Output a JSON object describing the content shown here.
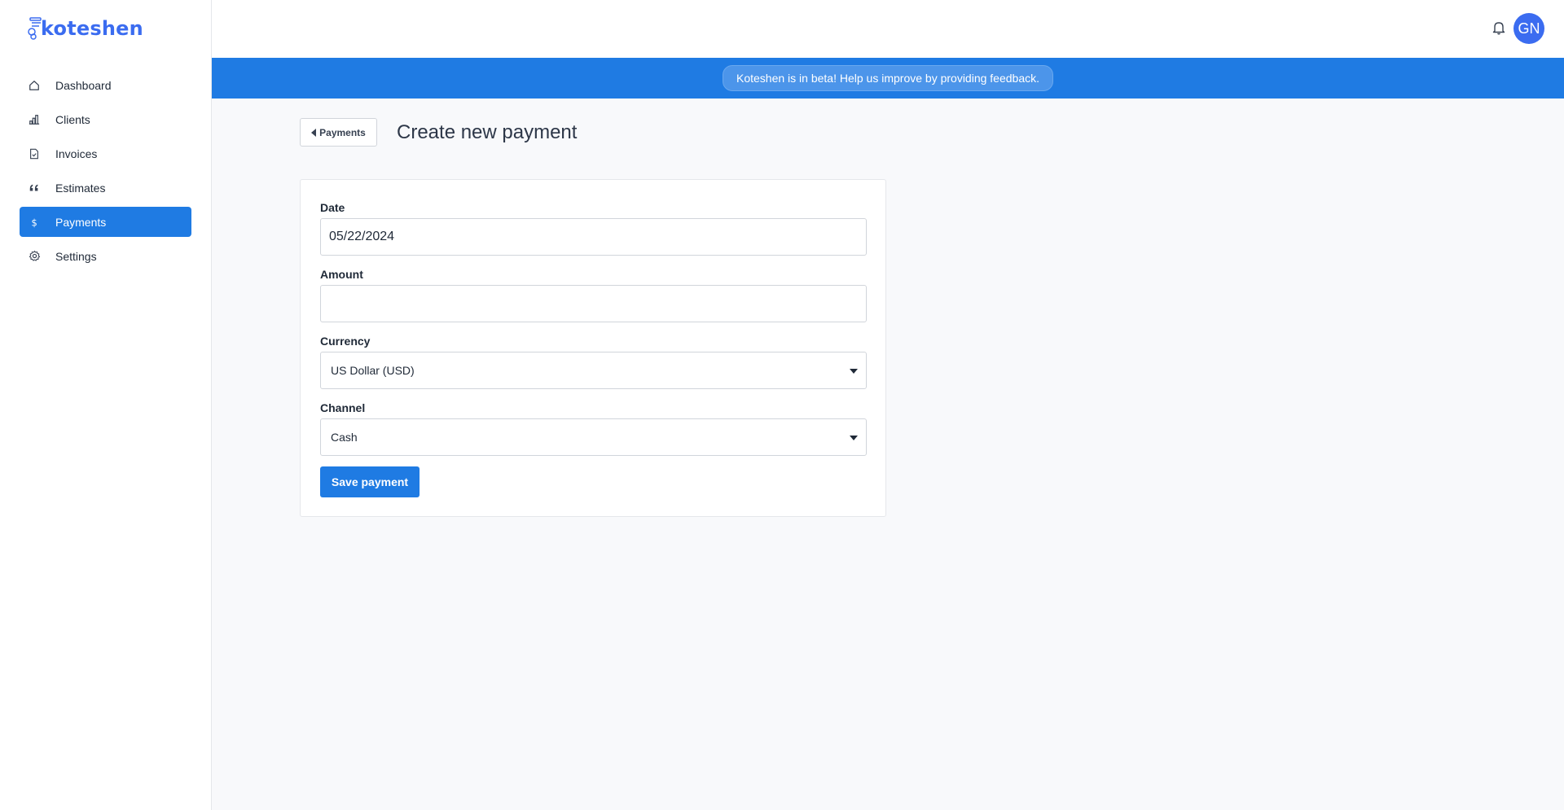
{
  "app": {
    "logo_text": "koteshen",
    "brand_color": "#3b6cf0",
    "accent_color": "#1f7be3"
  },
  "sidebar": {
    "items": [
      {
        "label": "Dashboard",
        "icon": "home-icon",
        "active": false
      },
      {
        "label": "Clients",
        "icon": "bar-chart-icon",
        "active": false
      },
      {
        "label": "Invoices",
        "icon": "document-check-icon",
        "active": false
      },
      {
        "label": "Estimates",
        "icon": "quote-icon",
        "active": false
      },
      {
        "label": "Payments",
        "icon": "dollar-icon",
        "active": true
      },
      {
        "label": "Settings",
        "icon": "gear-icon",
        "active": false
      }
    ]
  },
  "header": {
    "notifications_icon": "bell-icon",
    "avatar_initials": "GN"
  },
  "banner": {
    "text": "Koteshen is in beta! Help us improve by providing feedback."
  },
  "page": {
    "back_label": "Payments",
    "title": "Create new payment"
  },
  "form": {
    "date": {
      "label": "Date",
      "value": "05/22/2024"
    },
    "amount": {
      "label": "Amount",
      "value": ""
    },
    "currency": {
      "label": "Currency",
      "selected": "US Dollar (USD)"
    },
    "channel": {
      "label": "Channel",
      "selected": "Cash"
    },
    "submit_label": "Save payment"
  }
}
